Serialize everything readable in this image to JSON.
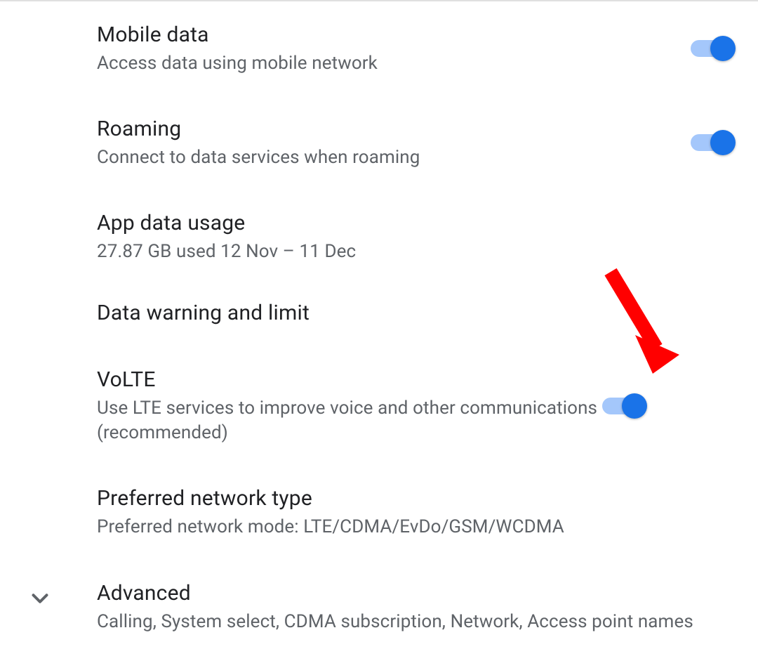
{
  "settings": {
    "mobile_data": {
      "title": "Mobile data",
      "subtitle": "Access data using mobile network",
      "enabled": true
    },
    "roaming": {
      "title": "Roaming",
      "subtitle": "Connect to data services when roaming",
      "enabled": true
    },
    "app_data_usage": {
      "title": "App data usage",
      "subtitle": "27.87 GB used 12 Nov – 11 Dec"
    },
    "data_warning_limit": {
      "title": "Data warning and limit"
    },
    "volte": {
      "title": "VoLTE",
      "subtitle": "Use LTE services to improve voice and other communications (recommended)",
      "enabled": true
    },
    "preferred_network_type": {
      "title": "Preferred network type",
      "subtitle": "Preferred network mode: LTE/CDMA/EvDo/GSM/WCDMA"
    },
    "advanced": {
      "title": "Advanced",
      "subtitle": "Calling, System select, CDMA subscription, Network, Access point names"
    }
  },
  "colors": {
    "toggle_track": "#a4c7fb",
    "toggle_thumb": "#1a73e8",
    "title_text": "#202124",
    "subtitle_text": "#5f6368",
    "arrow": "#ff0000"
  }
}
